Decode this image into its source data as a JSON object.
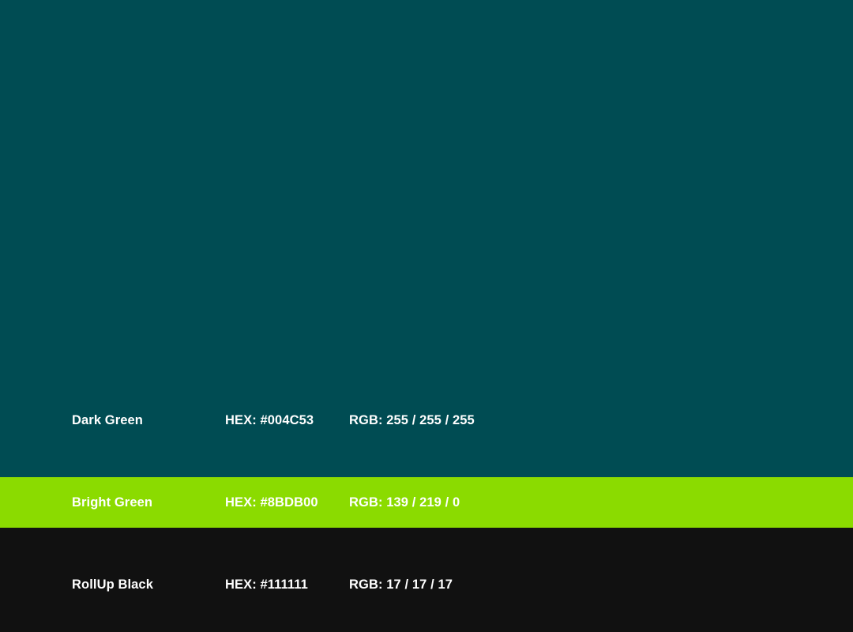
{
  "colors": [
    {
      "name": "Dark Green",
      "hex_label": "HEX: #004C53",
      "rgb_label": "RGB: 255 / 255 / 255",
      "swatch_color": "#004C53",
      "text_color": "#FFFFFF"
    },
    {
      "name": "Bright Green",
      "hex_label": "HEX: #8BDB00",
      "rgb_label": "RGB: 139 / 219 / 0",
      "swatch_color": "#8BDB00",
      "text_color": "#FFFFFF"
    },
    {
      "name": "RollUp Black",
      "hex_label": "HEX: #111111",
      "rgb_label": "RGB: 17 / 17 / 17",
      "swatch_color": "#111111",
      "text_color": "#FFFFFF"
    }
  ]
}
